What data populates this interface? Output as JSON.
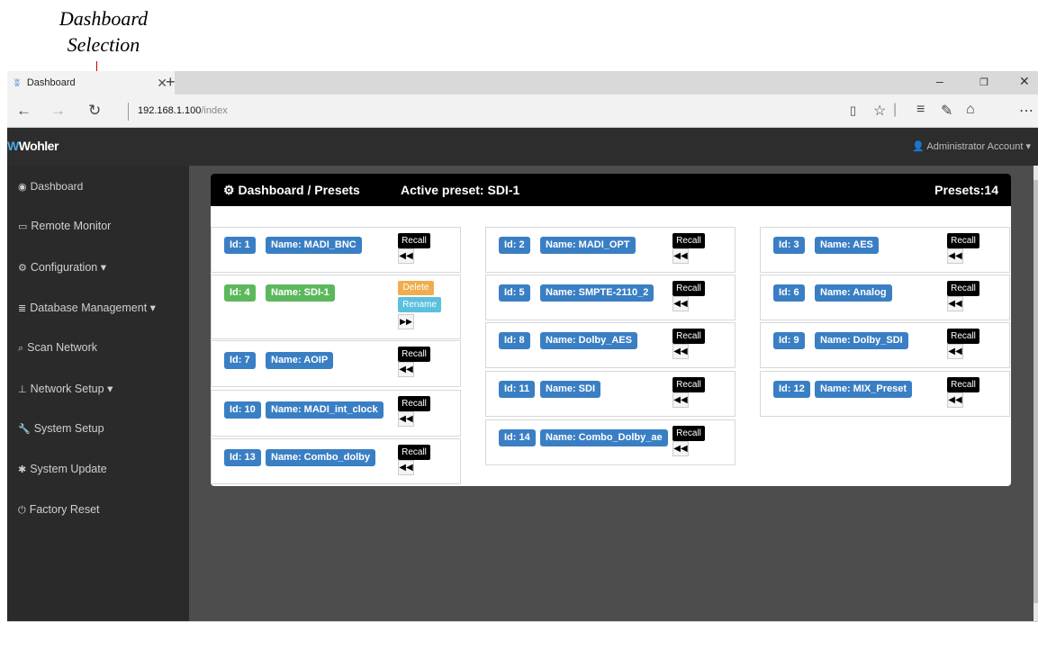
{
  "annotation": {
    "line1": "Dashboard",
    "line2": "Selection"
  },
  "browser": {
    "tab_title": "Dashboard",
    "favicon_icon": "wohler-favicon",
    "tab_close": "✕",
    "new_tab": "+",
    "url_host": "192.168.1.100",
    "url_path": "/index"
  },
  "app": {
    "logo": "Wohler",
    "account_label": "Administrator Account"
  },
  "sidebar": {
    "items": [
      {
        "label": "Dashboard",
        "icon": "dashboard-icon"
      },
      {
        "label": "Remote Monitor",
        "icon": "monitor-icon"
      },
      {
        "label": "Configuration",
        "icon": "gears-icon"
      },
      {
        "label": "Database Management",
        "icon": "database-icon"
      },
      {
        "label": "Scan Network",
        "icon": "search-icon"
      },
      {
        "label": "Network Setup",
        "icon": "sitemap-icon"
      },
      {
        "label": "System Setup",
        "icon": "wrench-icon"
      },
      {
        "label": "System Update",
        "icon": "gear-icon"
      },
      {
        "label": "Factory Reset",
        "icon": "power-icon"
      }
    ]
  },
  "panel": {
    "title": "Dashboard / Presets",
    "active_preset": "Active preset: SDI-1",
    "presets_count": "Presets:14"
  },
  "presets": [
    {
      "id": "Id: 1",
      "name": "Name: MADI_BNC",
      "state": "recall"
    },
    {
      "id": "Id: 2",
      "name": "Name: MADI_OPT",
      "state": "recall"
    },
    {
      "id": "Id: 3",
      "name": "Name: AES",
      "state": "recall"
    },
    {
      "id": "Id: 4",
      "name": "Name: SDI-1",
      "state": "active"
    },
    {
      "id": "Id: 5",
      "name": "Name: SMPTE-2110_2",
      "state": "recall"
    },
    {
      "id": "Id: 6",
      "name": "Name: Analog",
      "state": "recall"
    },
    {
      "id": "Id: 7",
      "name": "Name: AOIP",
      "state": "recall"
    },
    {
      "id": "Id: 8",
      "name": "Name: Dolby_AES",
      "state": "recall"
    },
    {
      "id": "Id: 9",
      "name": "Name: Dolby_SDI",
      "state": "recall"
    },
    {
      "id": "Id: 10",
      "name": "Name: MADI_int_clock",
      "state": "recall"
    },
    {
      "id": "Id: 11",
      "name": "Name: SDI",
      "state": "recall"
    },
    {
      "id": "Id: 12",
      "name": "Name: MIX_Preset",
      "state": "recall"
    },
    {
      "id": "Id: 13",
      "name": "Name: Combo_dolby",
      "state": "recall"
    },
    {
      "id": "Id: 14",
      "name": "Name: Combo_Dolby_ae",
      "state": "recall"
    }
  ],
  "buttons": {
    "recall": "Recall",
    "delete": "Delete",
    "rename": "Rename"
  },
  "colors": {
    "id_badge": "#3a7fc4",
    "active_badge": "#5cb85c",
    "delete": "#f0ad4e",
    "rename": "#5bc0de",
    "header_bg": "#000000",
    "sidebar_bg": "#2a2a2a"
  }
}
